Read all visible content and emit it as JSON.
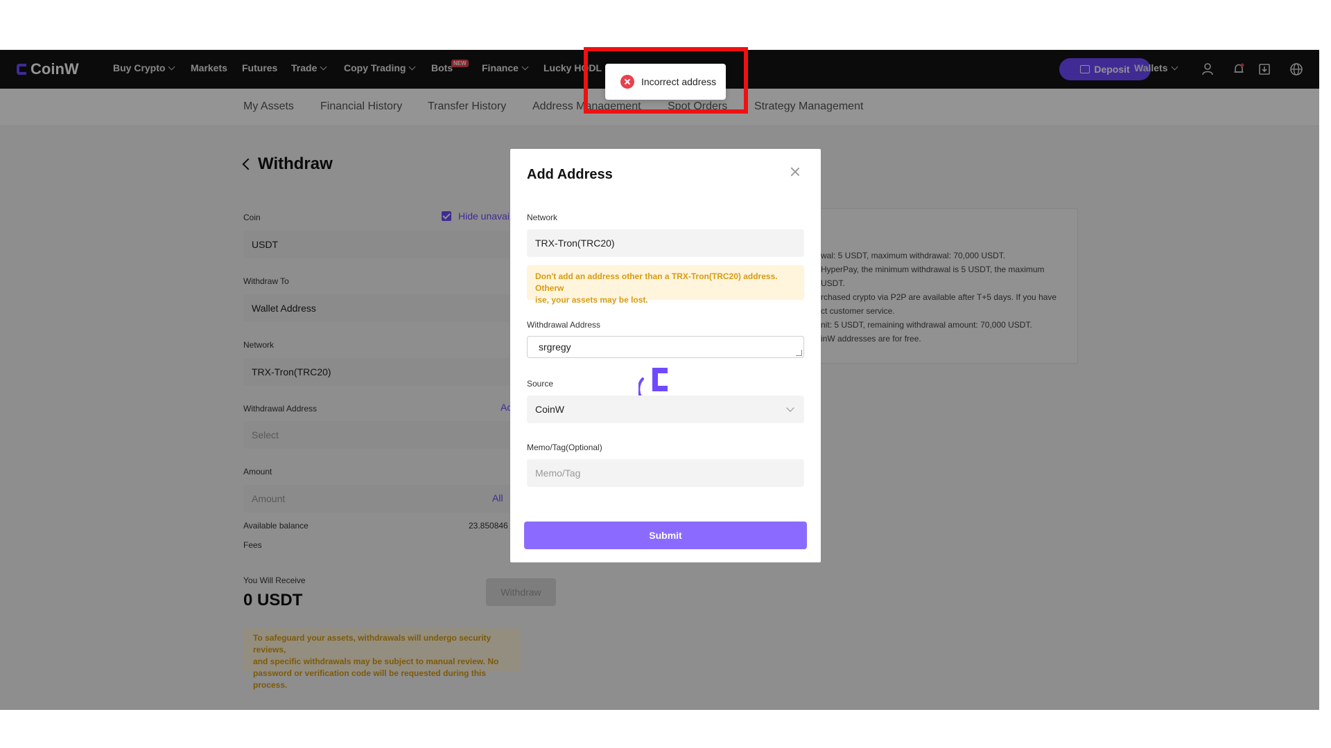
{
  "brand": {
    "name": "CoinW",
    "accent": "#6f4bff"
  },
  "nav": {
    "items": [
      {
        "label": "Buy Crypto",
        "dropdown": true
      },
      {
        "label": "Markets",
        "dropdown": false
      },
      {
        "label": "Futures",
        "dropdown": false
      },
      {
        "label": "Trade",
        "dropdown": true
      },
      {
        "label": "Copy Trading",
        "dropdown": true
      },
      {
        "label": "Bots",
        "dropdown": false,
        "badge": "NEW"
      },
      {
        "label": "Finance",
        "dropdown": true
      },
      {
        "label": "Lucky HODL",
        "dropdown": false
      }
    ],
    "deposit_label": "Deposit",
    "wallets_label": "Wallets",
    "icons": [
      "user-icon",
      "bell-icon",
      "download-icon",
      "globe-icon"
    ]
  },
  "subnav": {
    "items": [
      "My Assets",
      "Financial History",
      "Transfer History",
      "Address Management",
      "Spot Orders",
      "Strategy Management"
    ]
  },
  "withdraw": {
    "title": "Withdraw",
    "coin_label": "Coin",
    "coin_value": "USDT",
    "hide_unavailable": "Hide unavai",
    "withdraw_to_label": "Withdraw To",
    "withdraw_to_value": "Wallet Address",
    "network_label": "Network",
    "network_value": "TRX-Tron(TRC20)",
    "address_label": "Withdrawal Address",
    "address_link": "Ac",
    "address_placeholder": "Select",
    "amount_label": "Amount",
    "amount_placeholder": "Amount",
    "amount_all": "All",
    "balance_label": "Available balance",
    "balance_value": "23.850846",
    "fees_label": "Fees",
    "receive_label": "You Will Receive",
    "receive_value": "0 USDT",
    "withdraw_button": "Withdraw",
    "notice_lines": [
      "To safeguard your assets, withdrawals will undergo security reviews,",
      "and specific withdrawals may be subject to manual review. No",
      "password or verification code will be requested during this process."
    ]
  },
  "info_panel": {
    "lines": [
      "wal: 5 USDT, maximum withdrawal: 70,000 USDT.",
      "HyperPay, the minimum withdrawal is 5 USDT, the maximum",
      "USDT.",
      "rchased crypto via P2P are available after T+5 days. If you have",
      "ct customer service.",
      "nit: 5 USDT, remaining withdrawal amount: 70,000 USDT.",
      "inW addresses are for free."
    ]
  },
  "modal": {
    "title": "Add Address",
    "network_label": "Network",
    "network_value": "TRX-Tron(TRC20)",
    "warning_lines": [
      "Don't add an address other than a TRX-Tron(TRC20) address. Otherw",
      "ise, your assets may be lost."
    ],
    "address_label": "Withdrawal Address",
    "address_value": "srgregy",
    "source_label": "Source",
    "source_value": "CoinW",
    "memo_label": "Memo/Tag(Optional)",
    "memo_placeholder": "Memo/Tag",
    "submit_label": "Submit"
  },
  "toast": {
    "message": "Incorrect address",
    "color": "#e8414d"
  },
  "highlight_color": "#ee1111"
}
